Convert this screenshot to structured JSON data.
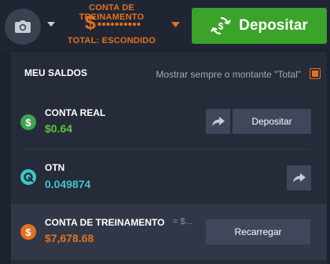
{
  "header": {
    "account_type": "CONTA DE TREINAMENTO",
    "balance_symbol": "$",
    "balance_masked": "••••••••••",
    "balance_status": "TOTAL: ESCONDIDO",
    "deposit_label": "Depositar",
    "camera_icon": "camera-icon"
  },
  "panel": {
    "title": "MEU SALDOS",
    "show_total_label": "Mostrar sempre o montante \"Total\"",
    "accounts": [
      {
        "name": "CONTA REAL",
        "value": "$0.64",
        "icon_glyph": "$",
        "icon_color": "#3fa34d",
        "value_color": "#5ec443",
        "action_label": "Depositar"
      },
      {
        "name": "OTN",
        "value": "0.049874",
        "icon_color": "#3dc7c9",
        "value_color": "#3dc7c9"
      },
      {
        "name": "CONTA DE TREINAMENTO",
        "value": "$7,678.68",
        "icon_glyph": "$",
        "icon_color": "#e2721d",
        "value_color": "#e2721d",
        "equals_hidden": "= $...",
        "action_label": "Recarregar"
      }
    ]
  },
  "colors": {
    "accent_orange": "#e2721d",
    "deposit_green": "#3ba22a",
    "background": "#1d2230",
    "panel": "#262b39"
  }
}
